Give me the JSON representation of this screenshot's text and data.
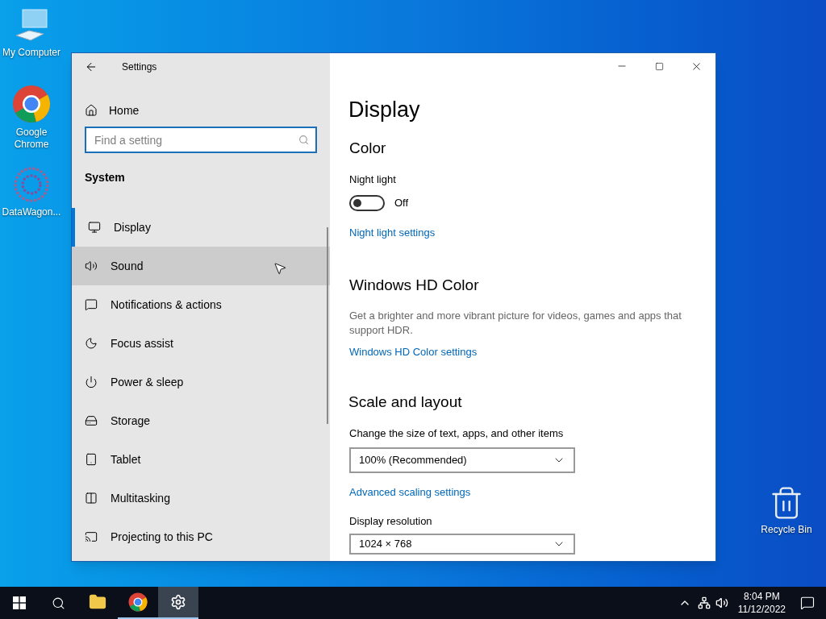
{
  "desktop_icons": [
    {
      "label": "My Computer"
    },
    {
      "label": "Google Chrome"
    },
    {
      "label": "DataWagon..."
    },
    {
      "label": "Recycle Bin"
    }
  ],
  "window": {
    "title": "Settings",
    "sidebar": {
      "home": "Home",
      "search": {
        "placeholder": "Find a setting"
      },
      "section": "System",
      "items": [
        {
          "label": "Display",
          "selected": true,
          "hovered": false
        },
        {
          "label": "Sound",
          "selected": false,
          "hovered": true
        },
        {
          "label": "Notifications & actions",
          "selected": false,
          "hovered": false
        },
        {
          "label": "Focus assist",
          "selected": false,
          "hovered": false
        },
        {
          "label": "Power & sleep",
          "selected": false,
          "hovered": false
        },
        {
          "label": "Storage",
          "selected": false,
          "hovered": false
        },
        {
          "label": "Tablet",
          "selected": false,
          "hovered": false
        },
        {
          "label": "Multitasking",
          "selected": false,
          "hovered": false
        },
        {
          "label": "Projecting to this PC",
          "selected": false,
          "hovered": false
        }
      ]
    },
    "content": {
      "title": "Display",
      "color": {
        "heading": "Color",
        "night_light": {
          "label": "Night light",
          "on": false,
          "state_text": "Off"
        },
        "link": "Night light settings"
      },
      "hd_color": {
        "heading": "Windows HD Color",
        "description": "Get a brighter and more vibrant picture for videos, games and apps that support HDR.",
        "link": "Windows HD Color settings"
      },
      "scale": {
        "heading": "Scale and layout",
        "size_label": "Change the size of text, apps, and other items",
        "size_value": "100% (Recommended)",
        "link": "Advanced scaling settings",
        "resolution_label": "Display resolution",
        "resolution_value": "1024 × 768"
      }
    }
  },
  "taskbar": {
    "apps": [
      {
        "selected": false
      },
      {
        "selected": false
      },
      {
        "selected": true
      }
    ],
    "time": "8:04 PM",
    "date": "11/12/2022"
  }
}
